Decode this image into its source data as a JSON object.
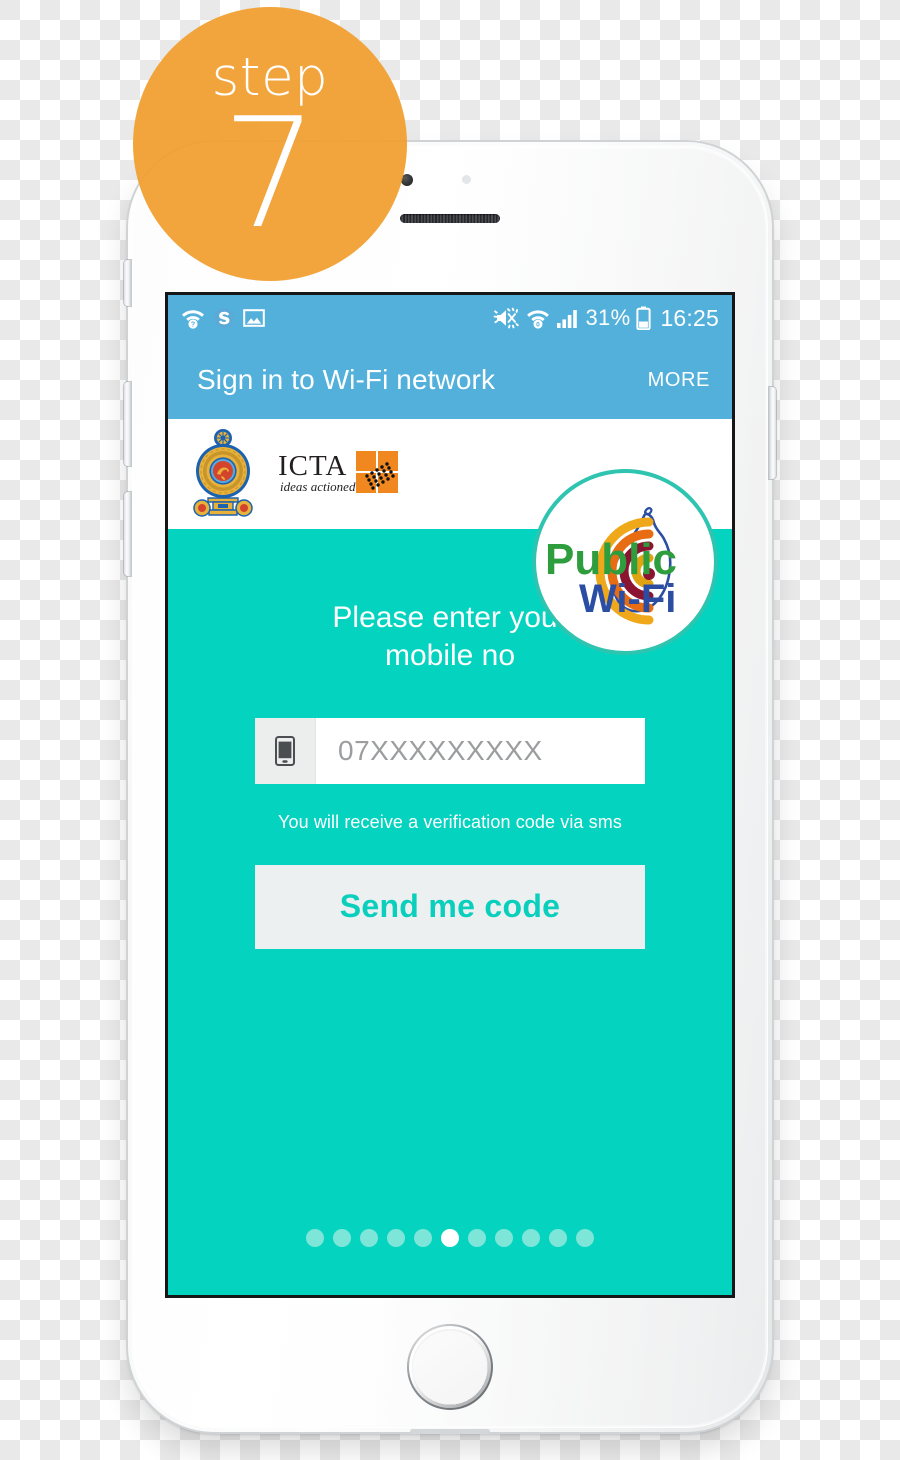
{
  "step_badge": {
    "word": "step",
    "number": "7",
    "color": "#f19e2e"
  },
  "device": {
    "name": "white-smartphone",
    "body_color": "#ffffff",
    "bezel_color": "#141618"
  },
  "screen": {
    "status_bar": {
      "background": "#52b0db",
      "left_icons": [
        "wifi-question-icon",
        "skype-s-icon",
        "image-icon"
      ],
      "right_icons": [
        "mute-icon",
        "wifi-icon",
        "signal-bars-icon",
        "battery-icon"
      ],
      "battery_percent": "31%",
      "clock": "16:25"
    },
    "action_bar": {
      "title": "Sign in to Wi-Fi network",
      "more_label": "MORE"
    },
    "logo_band": {
      "emblem_name": "sri-lanka-government-emblem",
      "icta_title": "ICTA",
      "icta_tagline": "ideas actioned"
    },
    "public_wifi_badge": {
      "line1": "Public",
      "line2": "Wi-Fi",
      "ring_color": "#2ec4b0",
      "public_color": "#2e9d3d",
      "wifi_color": "#2b4ea2"
    },
    "form": {
      "prompt_line1": "Please enter your",
      "prompt_line2": "mobile no",
      "phone_icon": "mobile-phone-icon",
      "phone_placeholder": "07XXXXXXXXX",
      "phone_value": "",
      "hint": "You will receive a verification code via sms",
      "submit_label": "Send me code",
      "accent_color": "#04d3c0",
      "button_bg": "#edf0f0"
    },
    "pagination": {
      "total": 11,
      "active_index": 5
    }
  }
}
